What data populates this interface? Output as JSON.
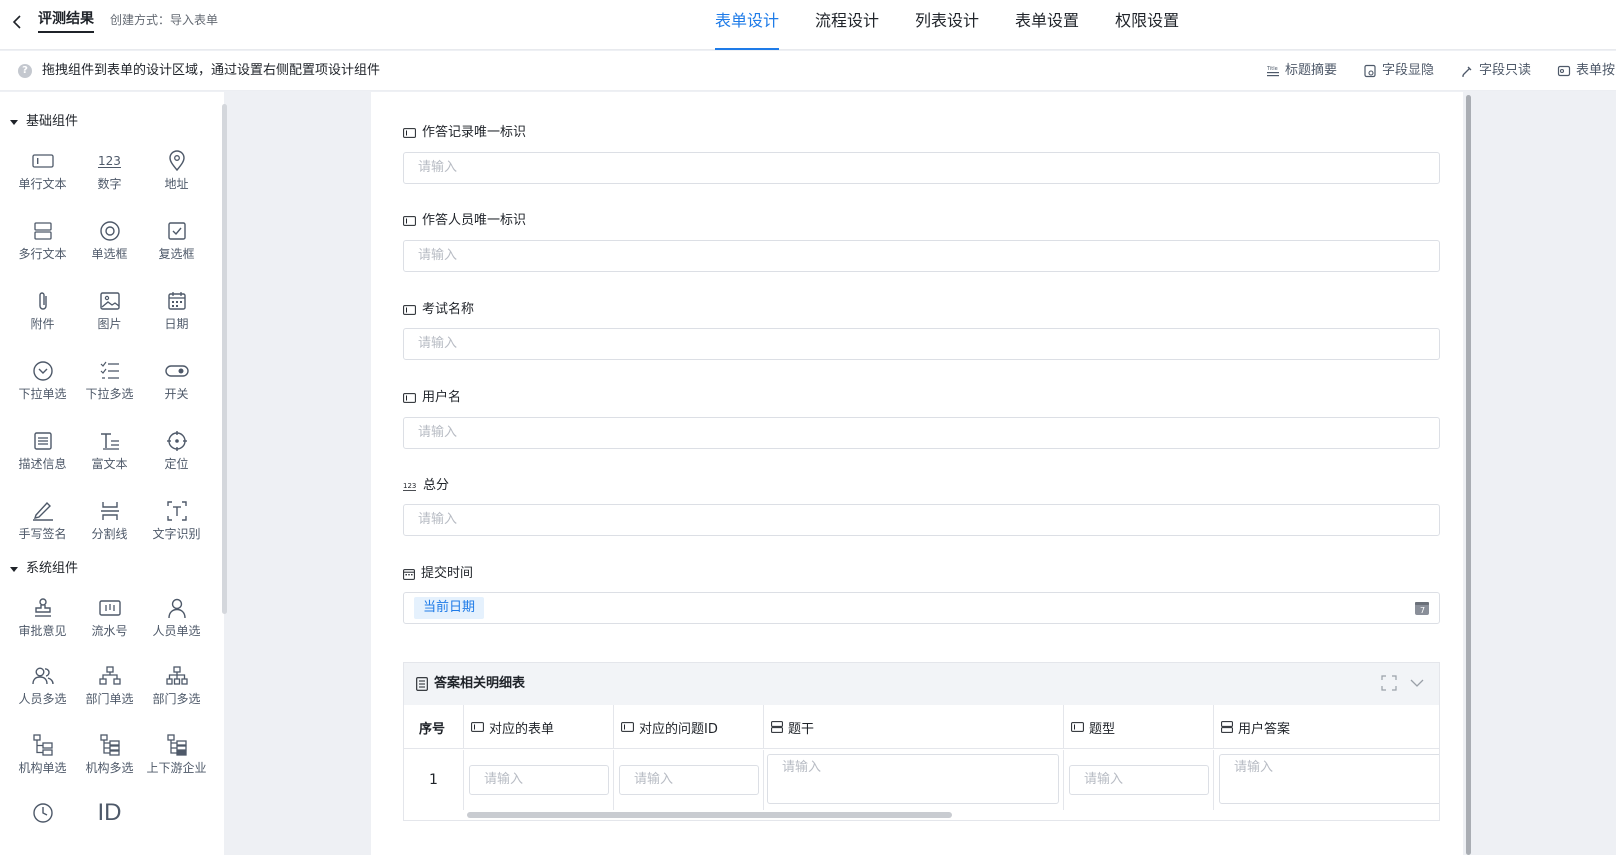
{
  "header": {
    "back_icon": "chevron-left-icon",
    "app_title": "评测结果",
    "create_way": "创建方式：导入表单",
    "tabs": [
      {
        "label": "表单设计",
        "active": true
      },
      {
        "label": "流程设计",
        "active": false
      },
      {
        "label": "列表设计",
        "active": false
      },
      {
        "label": "表单设置",
        "active": false
      },
      {
        "label": "权限设置",
        "active": false
      }
    ]
  },
  "hint": {
    "icon": "question-icon",
    "text": "拖拽组件到表单的设计区域，通过设置右侧配置项设计组件"
  },
  "actions": [
    {
      "label": "标题摘要",
      "icon": "title-summary-icon"
    },
    {
      "label": "字段显隐",
      "icon": "field-visibility-icon"
    },
    {
      "label": "字段只读",
      "icon": "field-readonly-icon"
    },
    {
      "label": "表单按",
      "icon": "form-button-icon"
    }
  ],
  "sidebar": {
    "basic_group": "基础组件",
    "basic_items": [
      {
        "label": "单行文本",
        "icon": "single-line-text-icon"
      },
      {
        "label": "数字",
        "icon": "number-icon"
      },
      {
        "label": "地址",
        "icon": "location-pin-icon"
      },
      {
        "label": "多行文本",
        "icon": "multi-line-text-icon"
      },
      {
        "label": "单选框",
        "icon": "radio-icon"
      },
      {
        "label": "复选框",
        "icon": "checkbox-icon"
      },
      {
        "label": "附件",
        "icon": "paperclip-icon"
      },
      {
        "label": "图片",
        "icon": "image-icon"
      },
      {
        "label": "日期",
        "icon": "calendar-icon"
      },
      {
        "label": "下拉单选",
        "icon": "dropdown-single-icon"
      },
      {
        "label": "下拉多选",
        "icon": "dropdown-multi-icon"
      },
      {
        "label": "开关",
        "icon": "toggle-icon"
      },
      {
        "label": "描述信息",
        "icon": "description-icon"
      },
      {
        "label": "富文本",
        "icon": "rich-text-icon"
      },
      {
        "label": "定位",
        "icon": "crosshair-icon"
      },
      {
        "label": "手写签名",
        "icon": "signature-icon"
      },
      {
        "label": "分割线",
        "icon": "divider-icon"
      },
      {
        "label": "文字识别",
        "icon": "ocr-icon"
      }
    ],
    "system_group": "系统组件",
    "system_items": [
      {
        "label": "审批意见",
        "icon": "stamp-icon"
      },
      {
        "label": "流水号",
        "icon": "serial-number-icon"
      },
      {
        "label": "人员单选",
        "icon": "user-icon"
      },
      {
        "label": "人员多选",
        "icon": "users-icon"
      },
      {
        "label": "部门单选",
        "icon": "org-single-icon"
      },
      {
        "label": "部门多选",
        "icon": "org-multi-icon"
      },
      {
        "label": "机构单选",
        "icon": "tree-single-icon"
      },
      {
        "label": "机构多选",
        "icon": "tree-multi-icon"
      },
      {
        "label": "上下游企业",
        "icon": "tree-enterprise-icon"
      },
      {
        "label": "",
        "icon": "clock-icon"
      },
      {
        "label": "",
        "icon": "id-icon",
        "glyph": "ID"
      }
    ]
  },
  "form": {
    "fields": [
      {
        "label": "作答记录唯一标识",
        "type": "text",
        "placeholder": "请输入"
      },
      {
        "label": "作答人员唯一标识",
        "type": "text",
        "placeholder": "请输入"
      },
      {
        "label": "考试名称",
        "type": "text",
        "placeholder": "请输入"
      },
      {
        "label": "用户名",
        "type": "text",
        "placeholder": "请输入"
      },
      {
        "label": "总分",
        "type": "number",
        "placeholder": "请输入"
      }
    ],
    "date_field": {
      "label": "提交时间",
      "value": "当前日期"
    },
    "subtable": {
      "title": "答案相关明细表",
      "columns": [
        {
          "label": "序号"
        },
        {
          "label": "对应的表单"
        },
        {
          "label": "对应的问题ID"
        },
        {
          "label": "题干"
        },
        {
          "label": "题型"
        },
        {
          "label": "用户答案"
        }
      ],
      "rows": [
        {
          "index": "1",
          "placeholder": "请输入"
        }
      ]
    }
  },
  "colors": {
    "accent": "#1e7be8",
    "text": "#1f2329",
    "placeholder": "#b8bcc4",
    "border": "#dcdfe5"
  }
}
